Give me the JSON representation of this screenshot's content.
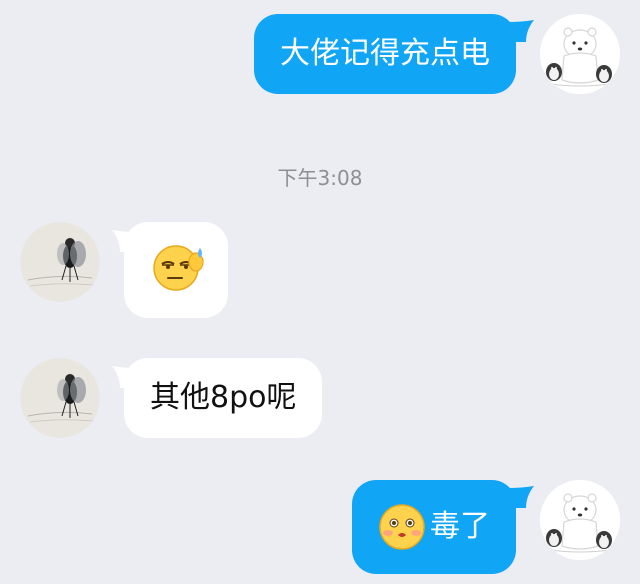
{
  "timestamp": "下午3:08",
  "messages": [
    {
      "direction": "outgoing",
      "text": "大佬记得充点电",
      "sender_avatar_icon": "polar-bear-penguin-avatar-icon"
    },
    {
      "direction": "incoming",
      "text": "",
      "emoji_icon": "facepalm-sweat-emoji-icon",
      "sender_avatar_icon": "fly-photo-avatar-icon"
    },
    {
      "direction": "incoming",
      "text": "其他8po呢",
      "sender_avatar_icon": "fly-photo-avatar-icon"
    },
    {
      "direction": "outgoing",
      "text": "毒了",
      "emoji_icon": "blush-pout-emoji-icon",
      "sender_avatar_icon": "polar-bear-penguin-avatar-icon"
    }
  ],
  "colors": {
    "background": "#ebedf2",
    "outgoing_bubble": "#11a5f6",
    "incoming_bubble": "#ffffff",
    "timestamp_text": "#8d8f94"
  }
}
